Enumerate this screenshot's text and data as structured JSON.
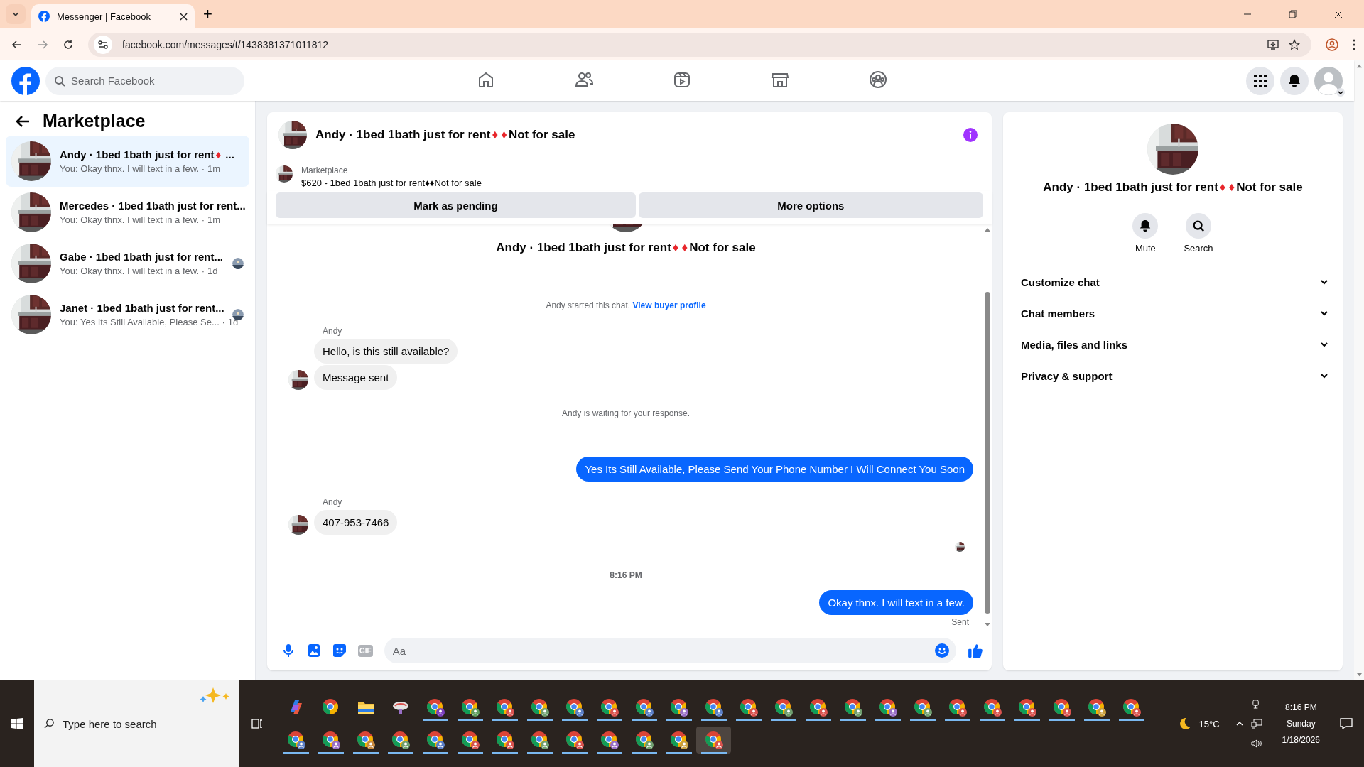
{
  "browser": {
    "tab": {
      "title": "Messenger | Facebook",
      "selected": true
    },
    "new_tab": "+",
    "url": "facebook.com/messages/t/1438381371011812"
  },
  "header": {
    "search": {
      "placeholder": "Search Facebook"
    },
    "nav": [
      {
        "kind": "home",
        "selected": false
      },
      {
        "kind": "friends",
        "selected": false
      },
      {
        "kind": "video",
        "selected": false
      },
      {
        "kind": "marketplace",
        "selected": false
      },
      {
        "kind": "groups",
        "selected": false
      }
    ]
  },
  "sidebar": {
    "title": "Marketplace",
    "conversations": [
      {
        "title": "Andy · 1bed 1bath just for rent♦ ...",
        "preview": "You: Okay thnx. I will text in a few. ·",
        "time": "1m",
        "selected": true,
        "seen": false
      },
      {
        "title": "Mercedes · 1bed 1bath just for rent...",
        "preview": "You: Okay thnx. I will text in a few. ·",
        "time": "1m",
        "selected": false,
        "seen": false
      },
      {
        "title": "Gabe · 1bed 1bath just for rent...",
        "preview": "You: Okay thnx. I will text in a few. ·",
        "time": "1d",
        "selected": false,
        "seen": true
      },
      {
        "title": "Janet · 1bed 1bath just for rent...",
        "preview": "You: Yes Its Still Available, Please Se... ·",
        "time": "1d",
        "selected": false,
        "seen": true
      }
    ]
  },
  "chat": {
    "title": "Andy · 1bed 1bath just for rent♦♦Not for sale",
    "listing": {
      "label": "Marketplace",
      "text": "$620 - 1bed 1bath just for rent♦♦Not for sale"
    },
    "actions": [
      "Mark as pending",
      "More options"
    ],
    "intro": {
      "title": "Andy · 1bed 1bath just for rent♦♦Not for sale",
      "text": "Andy started this chat.",
      "link": "View buyer profile"
    },
    "messages": [
      {
        "kind": "sender",
        "text": "Andy"
      },
      {
        "kind": "incoming",
        "text": "Hello, is this still available?",
        "avatar": false
      },
      {
        "kind": "incoming",
        "text": "Message sent",
        "avatar": true
      },
      {
        "kind": "event",
        "text": "Andy is waiting for your response."
      },
      {
        "kind": "outgoing",
        "text": "Yes Its Still Available, Please Send Your Phone Number I Will Connect You Soon"
      },
      {
        "kind": "sender",
        "text": "Andy"
      },
      {
        "kind": "incoming",
        "text": "407-953-7466",
        "avatar": true
      },
      {
        "kind": "seen"
      },
      {
        "kind": "time",
        "text": "8:16 PM"
      },
      {
        "kind": "outgoing",
        "text": "Okay thnx. I will text in a few."
      },
      {
        "kind": "status",
        "text": "Sent"
      }
    ],
    "composer": {
      "placeholder": "Aa",
      "gif": "GIF"
    }
  },
  "details": {
    "title": "Andy · 1bed 1bath just for rent♦♦Not for sale",
    "actions": [
      {
        "kind": "mute",
        "label": "Mute"
      },
      {
        "kind": "search",
        "label": "Search"
      }
    ],
    "sections": [
      {
        "label": "Customize chat",
        "expanded": false
      },
      {
        "label": "Chat members",
        "expanded": false
      },
      {
        "label": "Media, files and links",
        "expanded": false
      },
      {
        "label": "Privacy & support",
        "expanded": false
      }
    ]
  },
  "taskbar": {
    "search": {
      "placeholder": "Type here to search"
    },
    "apps": [
      {
        "kind": "copilot",
        "running": false,
        "selected": false
      },
      {
        "kind": "chrome",
        "running": false,
        "selected": false
      },
      {
        "kind": "files",
        "running": false,
        "selected": false
      },
      {
        "kind": "app",
        "running": false,
        "selected": false
      },
      {
        "kind": "profile",
        "color": "#7b3fbf",
        "running": true,
        "selected": false
      },
      {
        "kind": "profile",
        "color": "#5f9e5f",
        "running": true,
        "selected": false
      },
      {
        "kind": "profile",
        "color": "#d9534f",
        "running": true,
        "selected": false
      },
      {
        "kind": "profile",
        "color": "#6f9f6f",
        "running": true,
        "selected": false
      },
      {
        "kind": "profile",
        "color": "#5b7fc7",
        "running": true,
        "selected": false
      },
      {
        "kind": "profile",
        "color": "#d9534f",
        "running": true,
        "selected": false
      },
      {
        "kind": "profile",
        "color": "#5b7fc7",
        "running": true,
        "selected": false
      },
      {
        "kind": "profile",
        "color": "#9a6fc7",
        "running": true,
        "selected": false
      },
      {
        "kind": "profile",
        "color": "#5b7fc7",
        "running": true,
        "selected": false
      },
      {
        "kind": "profile",
        "color": "#d9534f",
        "running": true,
        "selected": false
      },
      {
        "kind": "profile",
        "color": "#6f9f6f",
        "running": true,
        "selected": false
      },
      {
        "kind": "profile",
        "color": "#d9534f",
        "running": true,
        "selected": false
      },
      {
        "kind": "profile",
        "color": "#6f9f6f",
        "running": true,
        "selected": false
      },
      {
        "kind": "profile",
        "color": "#9a6fc7",
        "running": true,
        "selected": false
      },
      {
        "kind": "profile",
        "color": "#6f9f6f",
        "running": true,
        "selected": false
      },
      {
        "kind": "profile",
        "color": "#d9534f",
        "running": true,
        "selected": false
      },
      {
        "kind": "profile",
        "color": "#d9534f",
        "running": true,
        "selected": false
      },
      {
        "kind": "profile",
        "color": "#d9534f",
        "running": true,
        "selected": false
      },
      {
        "kind": "profile",
        "color": "#d9534f",
        "running": true,
        "selected": false
      },
      {
        "kind": "profile",
        "color": "#c9a03f",
        "running": true,
        "selected": false
      },
      {
        "kind": "profile",
        "color": "#d9534f",
        "running": true,
        "selected": false
      },
      {
        "kind": "profile",
        "color": "#5b7fc7",
        "running": true,
        "selected": false
      },
      {
        "kind": "profile",
        "color": "#9a6fc7",
        "running": true,
        "selected": false
      },
      {
        "kind": "profile",
        "color": "#c98a3f",
        "running": true,
        "selected": false
      },
      {
        "kind": "profile",
        "color": "#6f9f6f",
        "running": true,
        "selected": false
      },
      {
        "kind": "profile",
        "color": "#5b7fc7",
        "running": true,
        "selected": false
      },
      {
        "kind": "profile",
        "color": "#d9534f",
        "running": true,
        "selected": false
      },
      {
        "kind": "profile",
        "color": "#d9534f",
        "running": true,
        "selected": false
      },
      {
        "kind": "profile",
        "color": "#6f9f6f",
        "running": true,
        "selected": false
      },
      {
        "kind": "profile",
        "color": "#d9534f",
        "running": true,
        "selected": false
      },
      {
        "kind": "profile",
        "color": "#9a6fc7",
        "running": true,
        "selected": false
      },
      {
        "kind": "profile",
        "color": "#6f9f6f",
        "running": true,
        "selected": false
      },
      {
        "kind": "profile",
        "color": "#c9a03f",
        "running": true,
        "selected": false
      },
      {
        "kind": "profile",
        "color": "#d9534f",
        "running": true,
        "selected": true
      }
    ],
    "weather": "15°C",
    "time": "8:16 PM",
    "day": "Sunday",
    "date": "1/18/2026"
  }
}
